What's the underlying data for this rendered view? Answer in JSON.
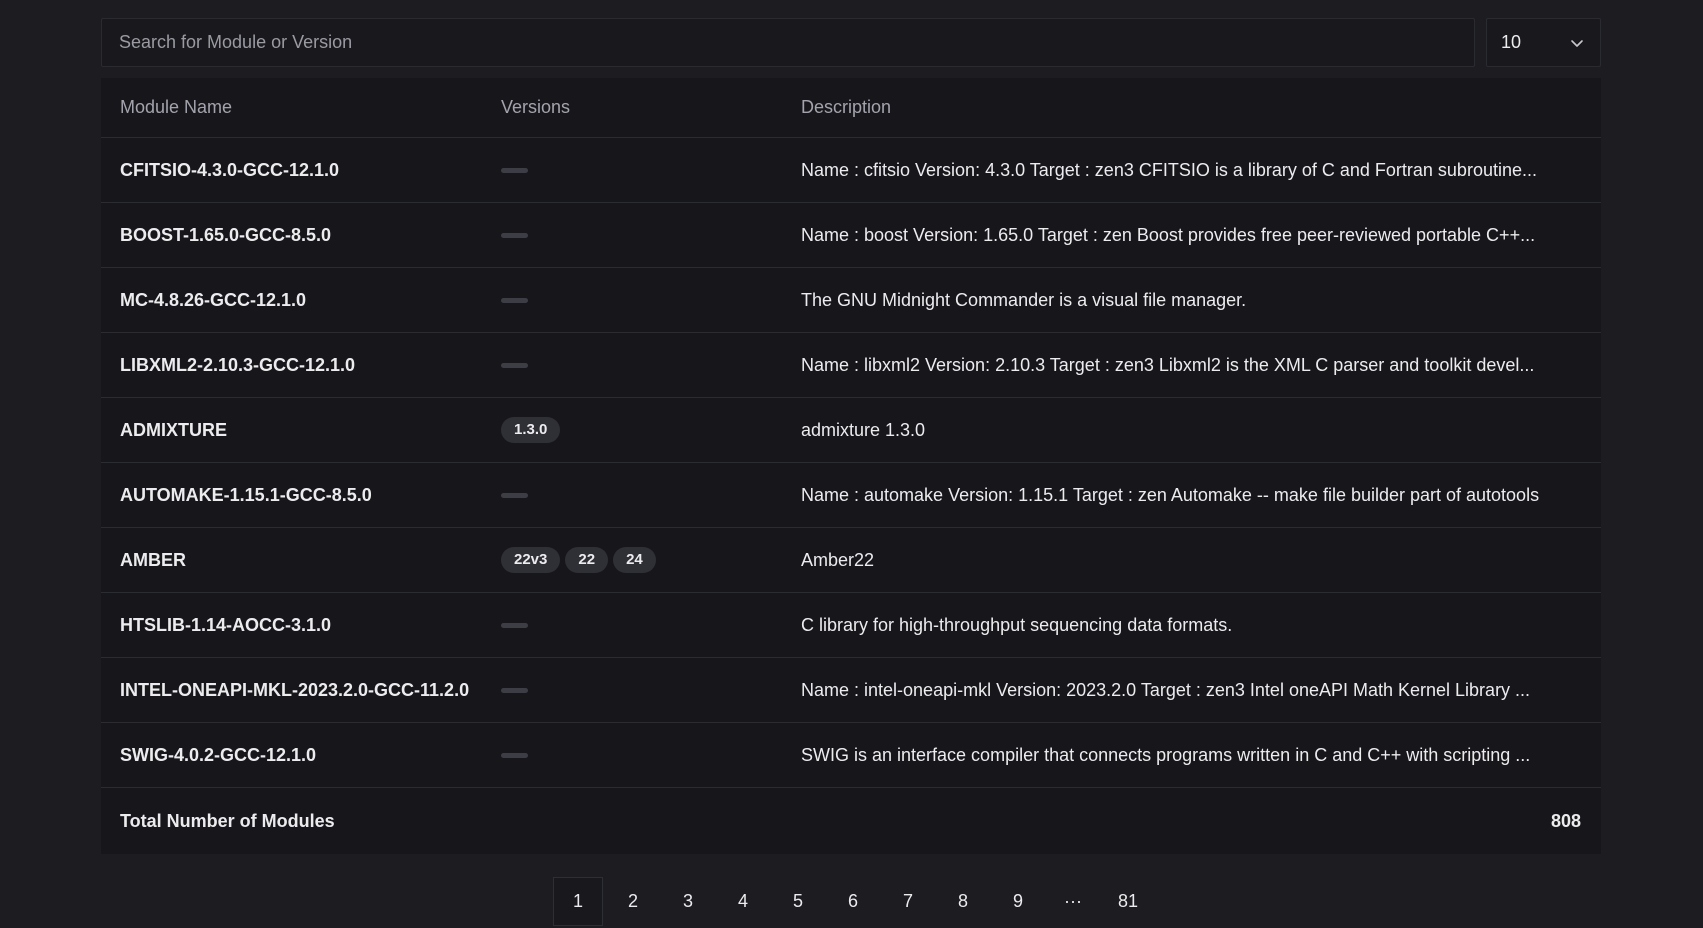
{
  "search": {
    "placeholder": "Search for Module or Version"
  },
  "page_size": {
    "value": "10"
  },
  "table": {
    "headers": {
      "name": "Module Name",
      "versions": "Versions",
      "description": "Description"
    },
    "rows": [
      {
        "name": "CFITSIO-4.3.0-GCC-12.1.0",
        "versions": [],
        "description": "Name : cfitsio Version: 4.3.0 Target : zen3 CFITSIO is a library of C and Fortran subroutine..."
      },
      {
        "name": "BOOST-1.65.0-GCC-8.5.0",
        "versions": [],
        "description": "Name : boost Version: 1.65.0 Target : zen Boost provides free peer-reviewed portable C++..."
      },
      {
        "name": "MC-4.8.26-GCC-12.1.0",
        "versions": [],
        "description": "The GNU Midnight Commander is a visual file manager."
      },
      {
        "name": "LIBXML2-2.10.3-GCC-12.1.0",
        "versions": [],
        "description": "Name : libxml2 Version: 2.10.3 Target : zen3 Libxml2 is the XML C parser and toolkit devel..."
      },
      {
        "name": "ADMIXTURE",
        "versions": [
          "1.3.0"
        ],
        "description": "admixture 1.3.0"
      },
      {
        "name": "AUTOMAKE-1.15.1-GCC-8.5.0",
        "versions": [],
        "description": "Name : automake Version: 1.15.1 Target : zen Automake -- make file builder part of autotools"
      },
      {
        "name": "AMBER",
        "versions": [
          "22v3",
          "22",
          "24"
        ],
        "description": "Amber22"
      },
      {
        "name": "HTSLIB-1.14-AOCC-3.1.0",
        "versions": [],
        "description": "C library for high-throughput sequencing data formats."
      },
      {
        "name": "INTEL-ONEAPI-MKL-2023.2.0-GCC-11.2.0",
        "versions": [],
        "description": "Name : intel-oneapi-mkl Version: 2023.2.0 Target : zen3 Intel oneAPI Math Kernel Library ..."
      },
      {
        "name": "SWIG-4.0.2-GCC-12.1.0",
        "versions": [],
        "description": "SWIG is an interface compiler that connects programs written in C and C++ with scripting ..."
      }
    ],
    "footer": {
      "label": "Total Number of Modules",
      "count": "808"
    }
  },
  "pagination": {
    "pages": [
      "1",
      "2",
      "3",
      "4",
      "5",
      "6",
      "7",
      "8",
      "9",
      "···",
      "81"
    ],
    "current": "1"
  },
  "colors": {
    "background": "#1c1c21",
    "table_background": "#17171b",
    "badge_background": "#2f2f36"
  },
  "icons": {
    "page_size_chevron": "chevron-down-icon",
    "empty_versions": "dash-icon"
  }
}
